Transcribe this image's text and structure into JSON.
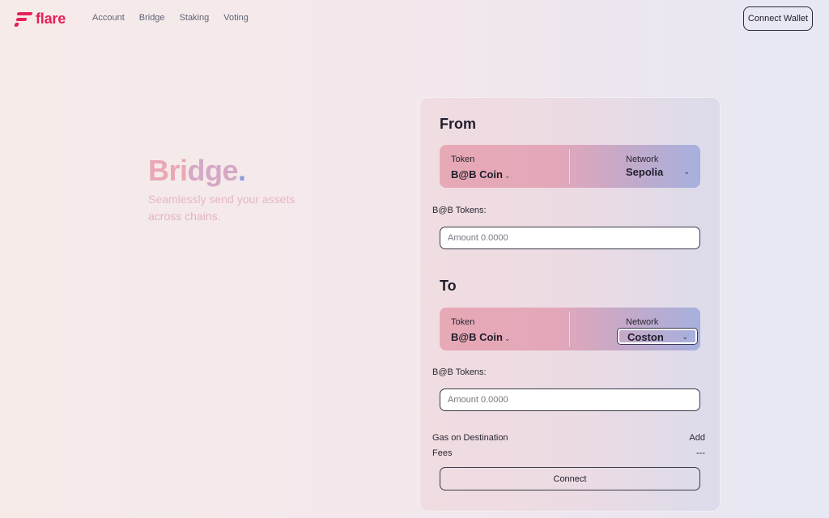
{
  "brand": {
    "name": "flare",
    "color": "#e62058"
  },
  "nav": {
    "items": [
      {
        "label": "Account"
      },
      {
        "label": "Bridge"
      },
      {
        "label": "Staking"
      },
      {
        "label": "Voting"
      }
    ],
    "connect_wallet_label": "Connect Wallet"
  },
  "hero": {
    "title_part1": "Bri",
    "title_part2": "dge",
    "title_dot": ".",
    "subtitle_line1": "Seamlessly send your assets",
    "subtitle_line2": "across chains."
  },
  "bridge": {
    "from": {
      "title": "From",
      "token_label": "Token",
      "token_value": "B@B Coin",
      "network_label": "Network",
      "network_value": "Sepolia",
      "amount_label": "B@B Tokens:",
      "amount_placeholder": "Amount 0.0000"
    },
    "to": {
      "title": "To",
      "token_label": "Token",
      "token_value": "B@B Coin",
      "network_label": "Network",
      "network_value": "Coston",
      "amount_label": "B@B Tokens:",
      "amount_placeholder": "Amount 0.0000"
    },
    "gas_label": "Gas on Destination",
    "gas_action": "Add",
    "fees_label": "Fees",
    "fees_value": "---",
    "connect_label": "Connect"
  },
  "icons": {
    "chevron": "chevron-down-icon",
    "logo": "flare-logo-icon"
  }
}
